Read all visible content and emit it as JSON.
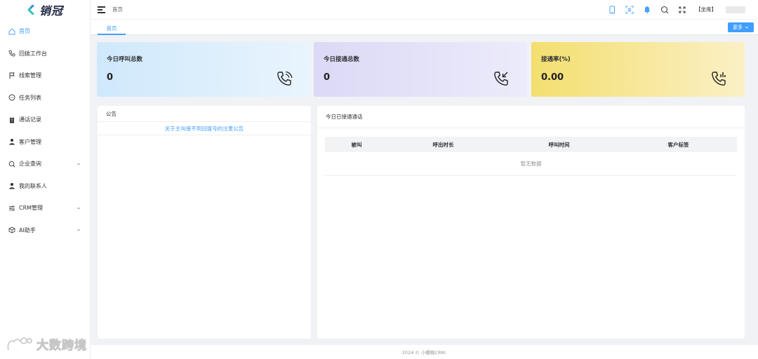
{
  "app": {
    "logo_text": "销冠",
    "brand_color": "#409eff"
  },
  "sidebar": {
    "items": [
      {
        "label": "首页",
        "icon": "home-icon",
        "active": true
      },
      {
        "label": "回拨工作台",
        "icon": "phone-icon"
      },
      {
        "label": "线索管理",
        "icon": "flag-icon"
      },
      {
        "label": "任务列表",
        "icon": "chat-icon"
      },
      {
        "label": "通话记录",
        "icon": "clipboard-icon"
      },
      {
        "label": "客户管理",
        "icon": "user-icon"
      },
      {
        "label": "企业查询",
        "icon": "search-icon",
        "expandable": true
      },
      {
        "label": "我的联系人",
        "icon": "user-icon"
      },
      {
        "label": "CRM管理",
        "icon": "sliders-icon",
        "expandable": true
      },
      {
        "label": "AI助手",
        "icon": "cube-icon",
        "expandable": true
      }
    ]
  },
  "header": {
    "breadcrumb": "首页",
    "seat_label": "【坐席】",
    "icons": [
      "tablet-icon",
      "scan-icon",
      "bell-icon",
      "search-icon",
      "fullscreen-icon"
    ]
  },
  "tabs": {
    "items": [
      {
        "label": "首页"
      }
    ],
    "more_label": "更多"
  },
  "stats": [
    {
      "title": "今日呼叫总数",
      "value": "0",
      "icon": "phone-call-icon"
    },
    {
      "title": "今日接通总数",
      "value": "0",
      "icon": "phone-incoming-icon"
    },
    {
      "title": "接通率(%)",
      "value": "0.00",
      "icon": "phone-signal-icon"
    }
  ],
  "notice": {
    "title": "公告",
    "link": "关于主叫接不到回拨号的注意公告"
  },
  "calls": {
    "title": "今日已接通通话",
    "columns": [
      "被叫",
      "呼出时长",
      "呼叫时间",
      "客户标签"
    ],
    "empty_text": "暂无数据"
  },
  "footer": {
    "text": "2024 © 小樱桃CRM."
  },
  "watermark": {
    "text": "大数跨境"
  }
}
